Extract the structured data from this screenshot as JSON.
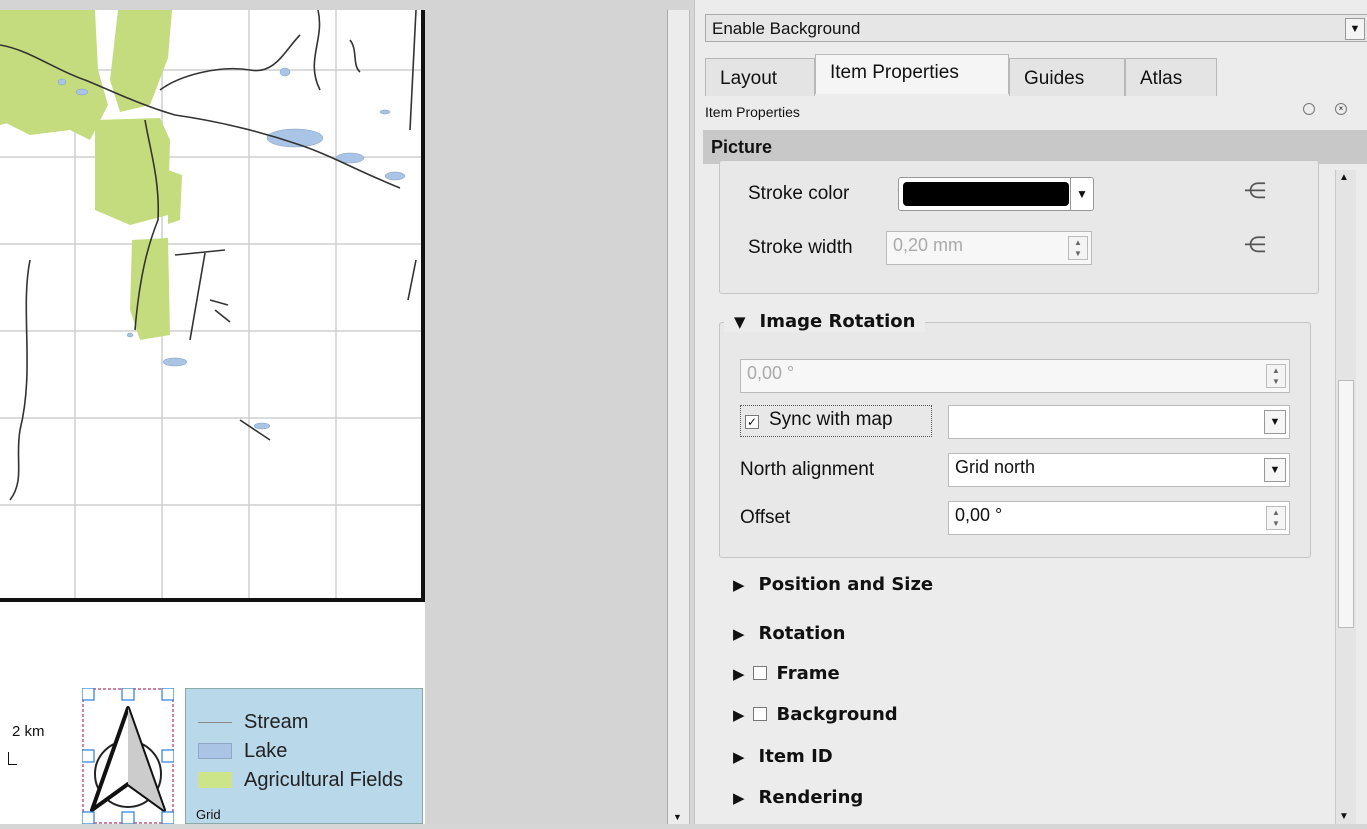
{
  "legend": {
    "items": [
      {
        "label": "Stream"
      },
      {
        "label": "Lake"
      },
      {
        "label": "Agricultural Fields"
      }
    ],
    "footer": "Grid"
  },
  "scalebar": {
    "label": "2 km"
  },
  "panel": {
    "top_combo": "Enable Background",
    "tabs": [
      "Layout",
      "Item Properties",
      "Guides",
      "Atlas"
    ],
    "active_tab": "Item Properties",
    "dock_title": "Item Properties",
    "section": "Picture",
    "stroke_color_label": "Stroke color",
    "stroke_color_value": "#000000",
    "stroke_width_label": "Stroke width",
    "stroke_width_value": "0,20 mm",
    "image_rotation": {
      "title": "Image Rotation",
      "rotation_value": "0,00 °",
      "sync_label": "Sync with map",
      "sync_checked": true,
      "sync_map_value": "",
      "north_label": "North alignment",
      "north_value": "Grid north",
      "offset_label": "Offset",
      "offset_value": "0,00 °"
    },
    "collapsed_sections": [
      {
        "label": "Position and Size",
        "has_checkbox": false
      },
      {
        "label": "Rotation",
        "has_checkbox": false
      },
      {
        "label": "Frame",
        "has_checkbox": true
      },
      {
        "label": "Background",
        "has_checkbox": true
      },
      {
        "label": "Item ID",
        "has_checkbox": false
      },
      {
        "label": "Rendering",
        "has_checkbox": false
      }
    ]
  },
  "colors": {
    "agri_fields": "#c5dc7e",
    "lake": "#a9c4e4",
    "legend_bg": "#b9d8ea"
  }
}
